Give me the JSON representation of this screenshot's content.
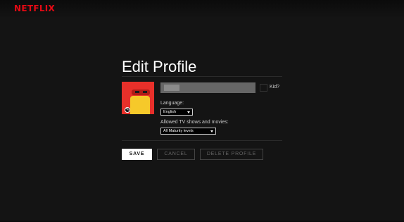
{
  "header": {
    "logo_text": "NETFLIX",
    "logo_color": "#e50914"
  },
  "profile": {
    "title": "Edit Profile",
    "avatar": {
      "icon": "profile-avatar-icon",
      "edit_icon": "pencil-icon"
    },
    "name": {
      "value": "",
      "placeholder": ""
    },
    "kid": {
      "label": "Kid?",
      "checked": false
    },
    "language": {
      "label": "Language:",
      "selected": "English"
    },
    "maturity": {
      "label": "Allowed TV shows and movies:",
      "selected": "All Maturity levels"
    }
  },
  "actions": {
    "save": "SAVE",
    "cancel": "CANCEL",
    "delete": "DELETE PROFILE"
  }
}
